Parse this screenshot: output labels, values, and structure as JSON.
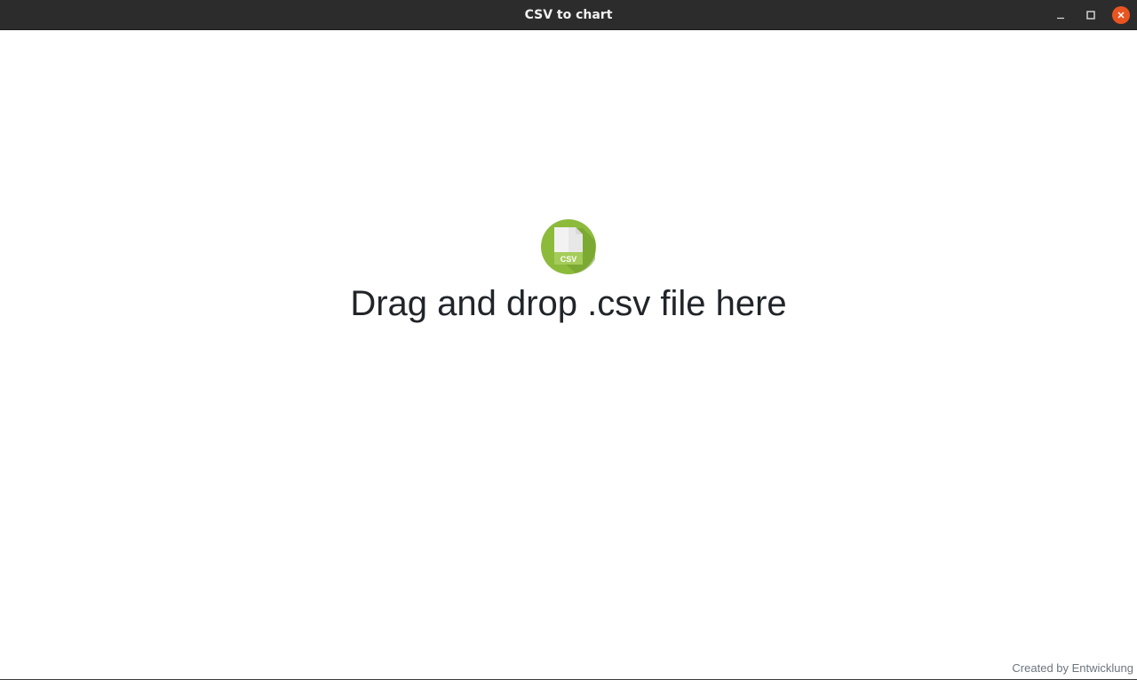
{
  "window": {
    "title": "CSV to chart",
    "controls": {
      "minimize": "minimize-icon",
      "maximize": "maximize-icon",
      "close": "close-icon"
    }
  },
  "dropzone": {
    "icon": "csv-file-icon",
    "icon_label": "CSV",
    "text": "Drag and drop .csv file here"
  },
  "footer": {
    "credit": "Created by Entwicklung"
  },
  "colors": {
    "titlebar": "#2c2c2c",
    "close_button": "#e95420",
    "icon_green": "#8cbb3c",
    "text": "#212529"
  }
}
